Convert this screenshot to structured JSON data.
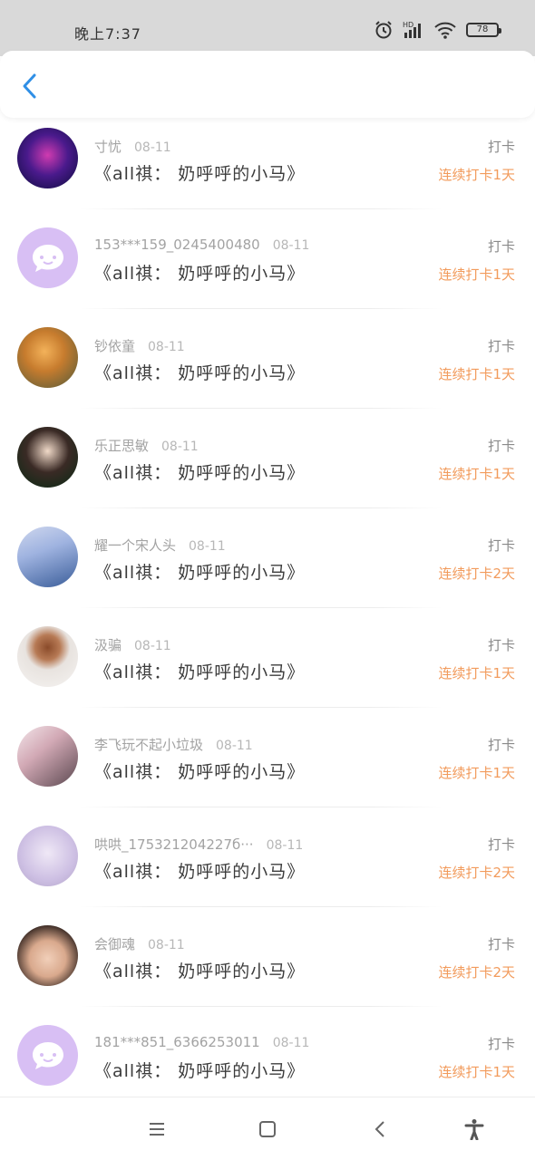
{
  "status_bar": {
    "time": "晚上7:37",
    "battery": "78",
    "icons": [
      "alarm-icon",
      "signal-icon",
      "wifi-icon",
      "battery-icon"
    ]
  },
  "header": {
    "back_icon": "chevron-left-icon"
  },
  "colors": {
    "accent": "#2f8fe6",
    "streak": "#f29b5c",
    "default_avatar": "#d8bff4"
  },
  "entries": [
    {
      "username": "寸忧",
      "date": "08-11",
      "book": "《all祺： 奶呼呼的小马》",
      "action": "打卡",
      "streak": "连续打卡1天",
      "avatar": "photo"
    },
    {
      "username": "153***159_0245400480",
      "date": "08-11",
      "book": "《all祺： 奶呼呼的小马》",
      "action": "打卡",
      "streak": "连续打卡1天",
      "avatar": "default"
    },
    {
      "username": "钞依童",
      "date": "08-11",
      "book": "《all祺： 奶呼呼的小马》",
      "action": "打卡",
      "streak": "连续打卡1天",
      "avatar": "photo"
    },
    {
      "username": "乐正思敏",
      "date": "08-11",
      "book": "《all祺： 奶呼呼的小马》",
      "action": "打卡",
      "streak": "连续打卡1天",
      "avatar": "photo"
    },
    {
      "username": "耀一个宋人头",
      "date": "08-11",
      "book": "《all祺： 奶呼呼的小马》",
      "action": "打卡",
      "streak": "连续打卡2天",
      "avatar": "photo"
    },
    {
      "username": "汲骗",
      "date": "08-11",
      "book": "《all祺： 奶呼呼的小马》",
      "action": "打卡",
      "streak": "连续打卡1天",
      "avatar": "photo"
    },
    {
      "username": "李飞玩不起小垃圾",
      "date": "08-11",
      "book": "《all祺： 奶呼呼的小马》",
      "action": "打卡",
      "streak": "连续打卡1天",
      "avatar": "photo"
    },
    {
      "username": "哄哄_175321204227б···",
      "date": "08-11",
      "book": "《all祺： 奶呼呼的小马》",
      "action": "打卡",
      "streak": "连续打卡2天",
      "avatar": "photo"
    },
    {
      "username": "会御魂",
      "date": "08-11",
      "book": "《all祺： 奶呼呼的小马》",
      "action": "打卡",
      "streak": "连续打卡2天",
      "avatar": "photo"
    },
    {
      "username": "181***851_6366253011",
      "date": "08-11",
      "book": "《all祺： 奶呼呼的小马》",
      "action": "打卡",
      "streak": "连续打卡1天",
      "avatar": "default"
    }
  ],
  "nav_bar": {
    "icons": [
      "menu-icon",
      "home-icon",
      "back-icon",
      "accessibility-icon"
    ]
  }
}
